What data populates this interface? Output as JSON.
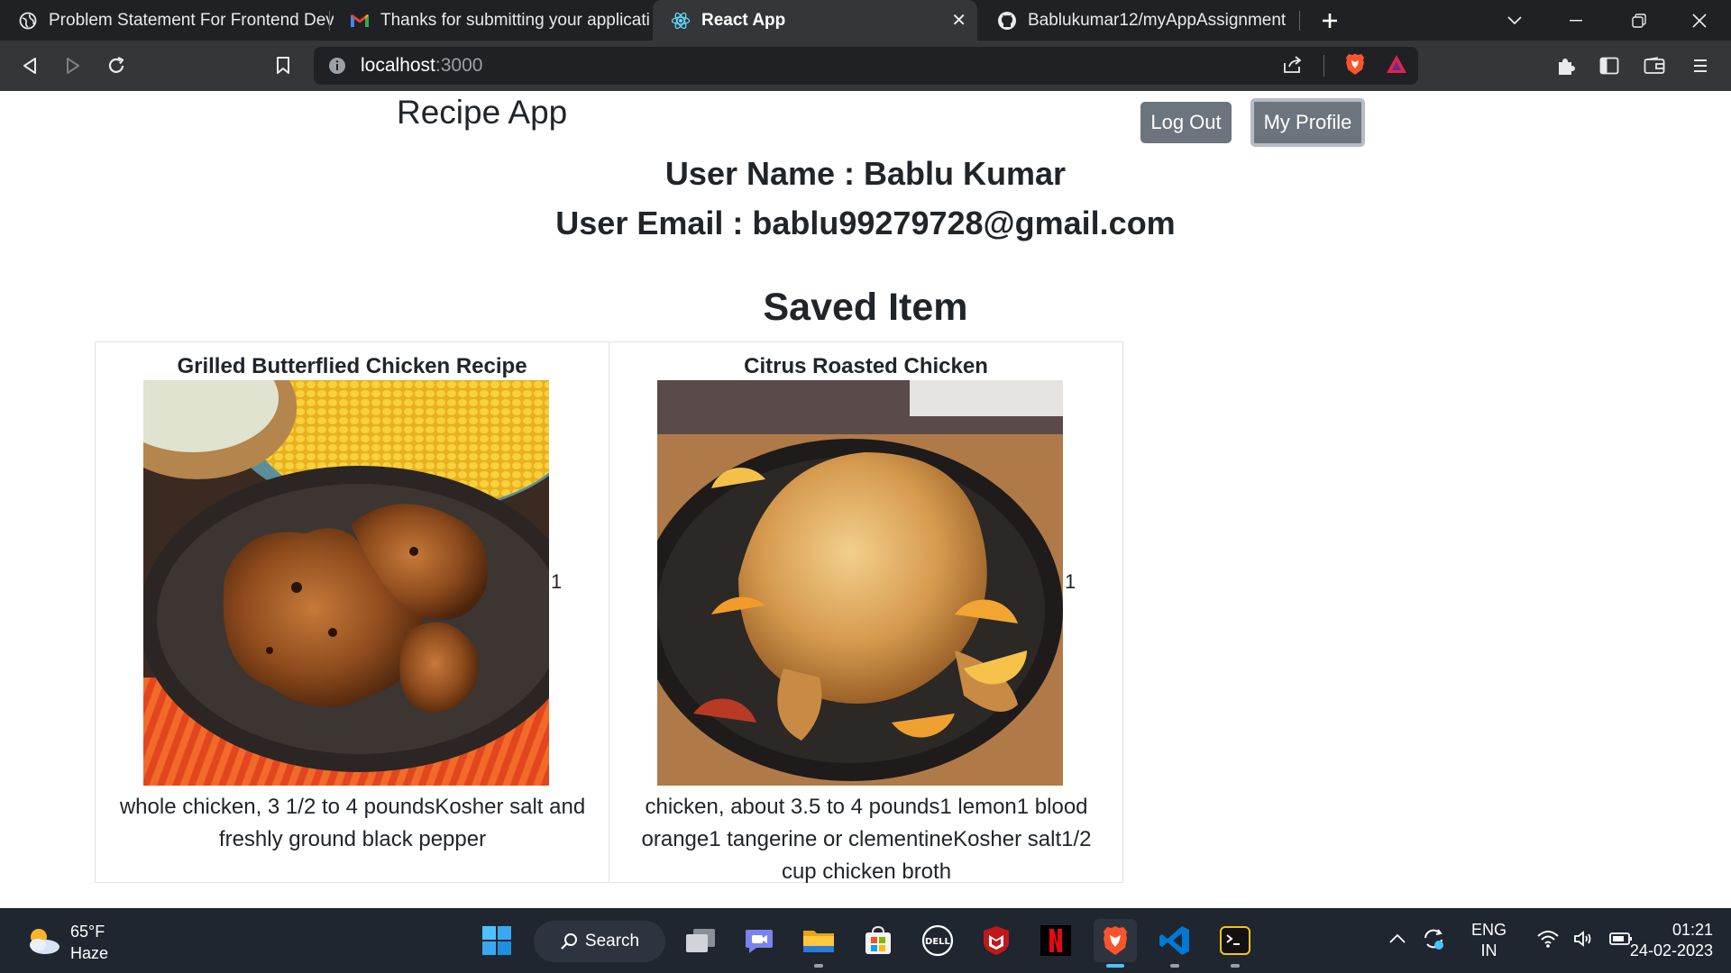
{
  "browser": {
    "tabs": [
      {
        "label": "Problem Statement For Frontend Deve",
        "icon": "globe-icon",
        "active": false
      },
      {
        "label": "Thanks for submitting your application",
        "icon": "gmail-icon",
        "active": false
      },
      {
        "label": "React App",
        "icon": "react-icon",
        "active": true
      },
      {
        "label": "Bablukumar12/myAppAssignment",
        "icon": "github-icon",
        "active": false
      }
    ],
    "url_host": "localhost",
    "url_port": ":3000"
  },
  "app": {
    "title": "Recipe App",
    "logout_label": "Log Out",
    "profile_label": "My Profile",
    "user_name_line": "User Name : Bablu Kumar",
    "user_email_line": "User Email : bablu99279728@gmail.com",
    "saved_heading": "Saved Item",
    "saved_items": [
      {
        "title": "Grilled Butterflied Chicken Recipe",
        "count": "1",
        "ingredients": "whole chicken, 3 1/2 to 4 poundsKosher salt and freshly ground black pepper",
        "image": "grilled-chicken-photo"
      },
      {
        "title": "Citrus Roasted Chicken",
        "count": "1",
        "ingredients": "chicken, about 3.5 to 4 pounds1 lemon1 blood orange1 tangerine or clementineKosher salt1/2 cup chicken broth",
        "image": "roasted-chicken-photo"
      }
    ]
  },
  "taskbar": {
    "temperature": "65°F",
    "weather": "Haze",
    "search_label": "Search",
    "lang_line1": "ENG",
    "lang_line2": "IN",
    "time": "01:21",
    "date": "24-02-2023"
  },
  "colors": {
    "tab_strip": "#202124",
    "toolbar": "#35363a",
    "button": "#6c757d",
    "taskbar": "#1f2630",
    "brave_orange": "#fb542b"
  }
}
